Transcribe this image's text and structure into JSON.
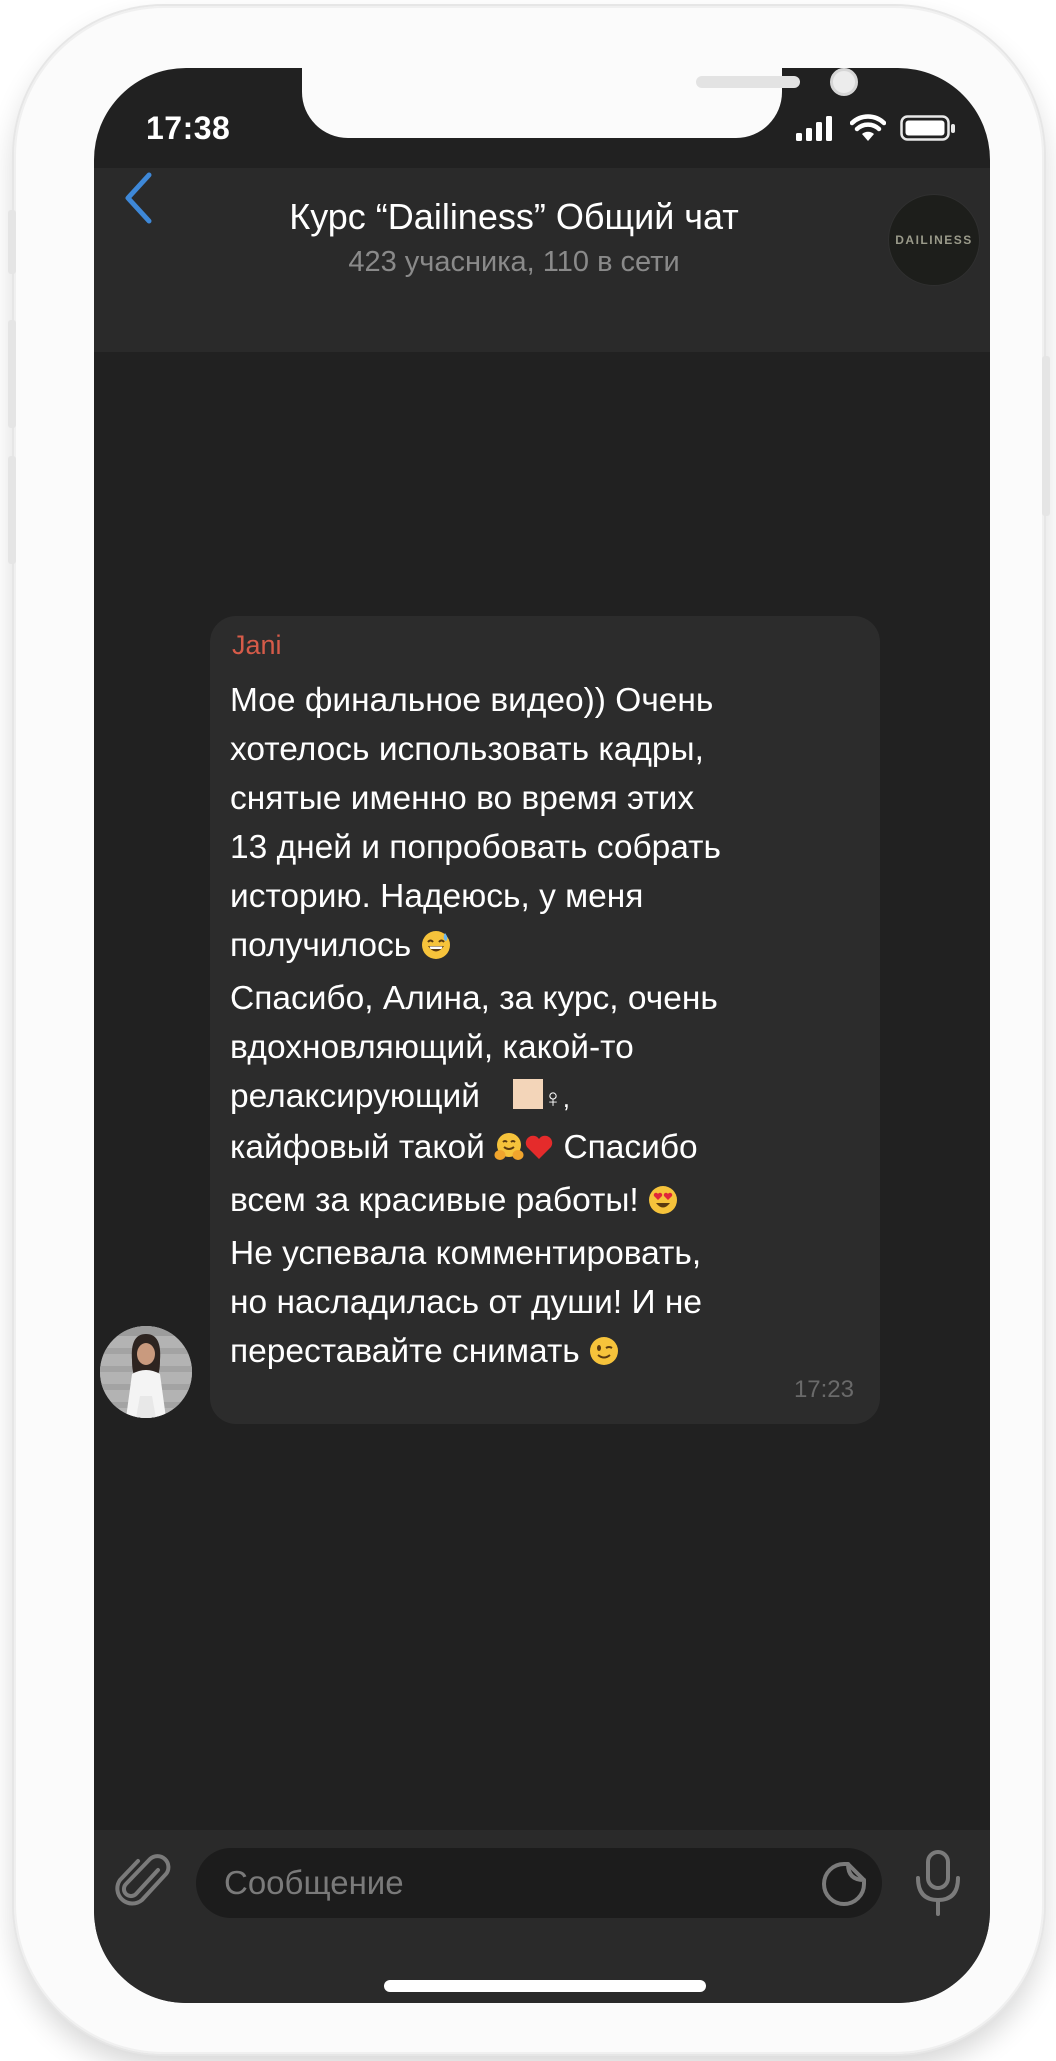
{
  "status_bar": {
    "time": "17:38"
  },
  "header": {
    "title": "Курс “Dailiness” Общий чат",
    "subtitle": "423 учасника, 110 в сети",
    "avatar_text": "DAILINESS"
  },
  "message": {
    "sender": "Jani",
    "lines": [
      "Мое финальное видео)) Очень",
      "хотелось использовать кадры,",
      "снятые именно во время этих",
      "13 дней и попробовать собрать",
      "историю. Надеюсь, у меня",
      "получилось",
      "Спасибо, Алина, за курс, очень",
      "вдохновляющий, какой-то",
      "релаксирующий",
      "♀,",
      "кайфовый такой",
      "Спасибо",
      "всем за красивые работы!",
      "Не успевала комментировать,",
      "но насладилась от души! И не",
      "переставайте снимать"
    ],
    "time": "17:23"
  },
  "input": {
    "placeholder": "Сообщение"
  },
  "colors": {
    "screen_bg": "#212121",
    "bar_bg": "#2a2a2a",
    "bubble_bg": "#2c2c2c",
    "sender_name": "#d65b49",
    "accent": "#3e88d8"
  },
  "icons": {
    "back": "chevron-left-icon",
    "attach": "paperclip-icon",
    "sticker": "sticker-icon",
    "mic": "microphone-icon",
    "signal": "signal-icon",
    "wifi": "wifi-icon",
    "battery": "battery-icon"
  }
}
